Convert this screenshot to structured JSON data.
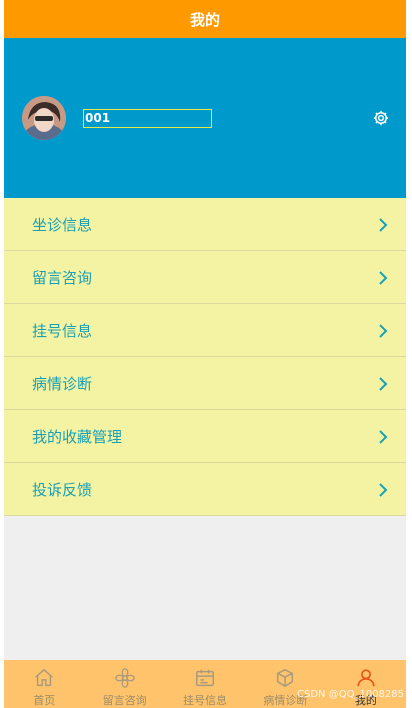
{
  "header": {
    "title": "我的"
  },
  "profile": {
    "username": "001"
  },
  "menu": {
    "items": [
      {
        "label": "坐诊信息"
      },
      {
        "label": "留言咨询"
      },
      {
        "label": "挂号信息"
      },
      {
        "label": "病情诊断"
      },
      {
        "label": "我的收藏管理"
      },
      {
        "label": "投诉反馈"
      }
    ]
  },
  "tabbar": {
    "tabs": [
      {
        "label": "首页",
        "icon": "home-icon"
      },
      {
        "label": "留言咨询",
        "icon": "flower-icon"
      },
      {
        "label": "挂号信息",
        "icon": "calendar-icon"
      },
      {
        "label": "病情诊断",
        "icon": "cube-icon"
      },
      {
        "label": "我的",
        "icon": "user-icon",
        "active": true
      }
    ]
  },
  "watermark": "CSDN @QQ_1008285",
  "colors": {
    "header": "#ff9900",
    "profile_bg": "#0099cc",
    "menu_bg": "#f3f3a3",
    "menu_text": "#1aa0b5",
    "tabbar_bg": "#ffc46b",
    "active_icon": "#e8541a"
  }
}
